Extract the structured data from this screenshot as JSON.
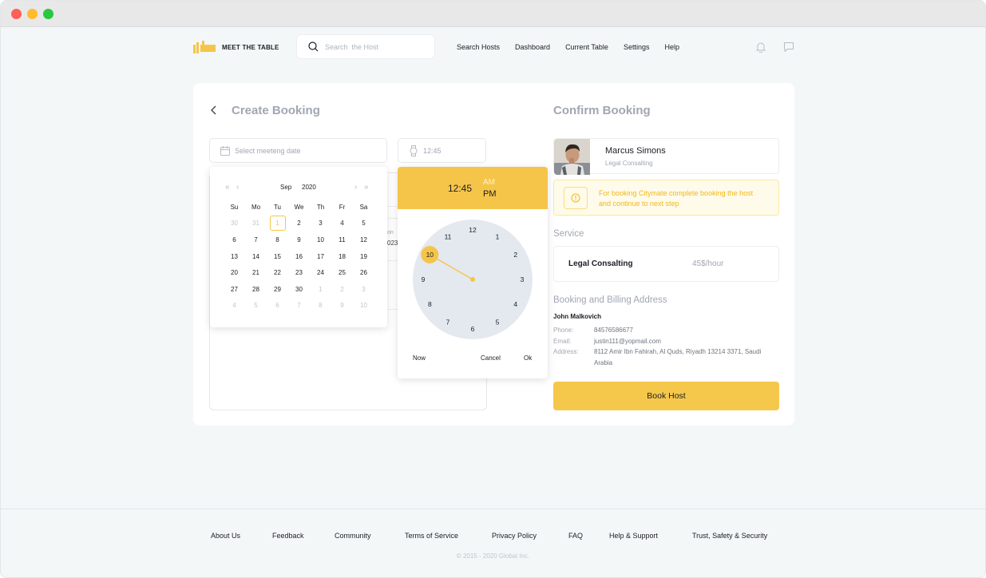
{
  "window": {
    "controls": [
      "close",
      "minimize",
      "maximize"
    ]
  },
  "header": {
    "logo_text": "MEET THE TABLE",
    "search_placeholder": "Search  the Host",
    "nav": [
      "Search Hosts",
      "Dashboard",
      "Current Table",
      "Settings",
      "Help"
    ],
    "icons": [
      "bell-icon",
      "chat-icon"
    ]
  },
  "booking": {
    "back_icon": "chevron-left-icon",
    "title": "Create Booking",
    "date_placeholder": "Select meeteng date",
    "time_value": "12:45",
    "bg_fragments": [
      "on",
      "023"
    ]
  },
  "calendar": {
    "month": "Sep",
    "year": "2020",
    "days_of_week": [
      "Su",
      "Mo",
      "Tu",
      "We",
      "Th",
      "Fr",
      "Sa"
    ],
    "weeks": [
      [
        "30",
        "31",
        "1",
        "2",
        "3",
        "4",
        "5"
      ],
      [
        "6",
        "7",
        "8",
        "9",
        "10",
        "11",
        "12"
      ],
      [
        "13",
        "14",
        "15",
        "16",
        "17",
        "18",
        "19"
      ],
      [
        "20",
        "21",
        "22",
        "23",
        "24",
        "25",
        "26"
      ],
      [
        "27",
        "28",
        "29",
        "30",
        "1",
        "2",
        "3"
      ],
      [
        "4",
        "5",
        "6",
        "7",
        "8",
        "9",
        "10"
      ]
    ],
    "selected_day": "1"
  },
  "clock": {
    "time": "12:45",
    "am_label": "AM",
    "pm_label": "PM",
    "selected_period": "PM",
    "selected_hour": 10,
    "numbers": [
      "12",
      "1",
      "2",
      "3",
      "4",
      "5",
      "6",
      "7",
      "8",
      "9",
      "10",
      "11"
    ],
    "buttons": {
      "now": "Now",
      "cancel": "Cancel",
      "ok": "Ok"
    }
  },
  "confirm": {
    "title": "Confirm Booking",
    "host": {
      "name": "Marcus Simons",
      "role": "Legal Consalting"
    },
    "alert": "For booking Citymate complete booking the host and continue to next step",
    "service_title": "Service",
    "service": {
      "name": "Legal Consalting",
      "price": "45$/hour"
    },
    "billing_title": "Booking and Billing Address",
    "billing": {
      "name": "John Malkovich",
      "phone_label": "Phone:",
      "phone": "84576586677",
      "email_label": "Email:",
      "email": "justin111@yopmail.com",
      "address_label": "Address:",
      "address": "8112 Amir Ibn Fahirah, Al Quds, Riyadh 13214 3371, Saudi Arabia"
    },
    "book_button": "Book Host"
  },
  "footer": {
    "links": [
      "About Us",
      "Feedback",
      "Community",
      "Terms of Service",
      "Privacy Policy",
      "FAQ",
      "Help & Support",
      "Trust, Safety & Security"
    ],
    "copyright": "© 2015 - 2020 Global Inc."
  },
  "colors": {
    "accent": "#f5c54a",
    "accent_text": "#f1b71c",
    "muted": "#a1a6b3"
  }
}
